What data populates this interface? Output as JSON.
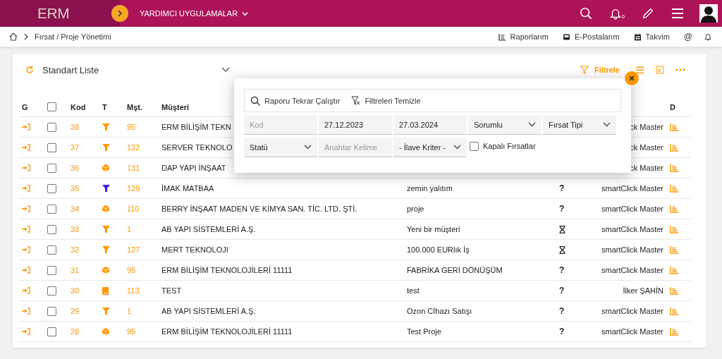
{
  "header": {
    "logo": "ERM",
    "app_menu": "YARDIMCI UYGULAMALAR",
    "notification_count": "0"
  },
  "breadcrumb": {
    "path": "Fırsat / Proje Yönetimi",
    "links": [
      {
        "kind": "reports",
        "label": "Raporlarım"
      },
      {
        "kind": "mail",
        "label": "E-Postalarım"
      },
      {
        "kind": "calendar",
        "label": "Takvim"
      }
    ],
    "at_sign": "@"
  },
  "list": {
    "title": "Standart Liste",
    "filter_label": "Filtrele"
  },
  "table": {
    "header": {
      "g": "G",
      "select_all_checked": false,
      "kod": "Kod",
      "type": "T",
      "mst": "Mşt.",
      "customer": "Müşteri",
      "d": "D"
    },
    "rows": [
      {
        "kod": "38",
        "checked": false,
        "type": {
          "kind": "funnel",
          "color": "#ff9800"
        },
        "mst": "95",
        "customer": "ERM BİLİŞİM TEKN",
        "owner": "ck Master"
      },
      {
        "kod": "37",
        "checked": false,
        "type": {
          "kind": "funnel",
          "color": "#ff9800"
        },
        "mst": "132",
        "customer": "SERVER TEKNOLO",
        "owner": "ck Master"
      },
      {
        "kod": "36",
        "checked": false,
        "type": {
          "kind": "box",
          "color": "#ff9800"
        },
        "mst": "131",
        "customer": "DAP YAPI İNŞAAT",
        "owner": "ck Master"
      },
      {
        "kod": "35",
        "checked": false,
        "type": {
          "kind": "funnel",
          "color": "#3a1ef0"
        },
        "mst": "129",
        "customer": "İMAK MATBAA",
        "subject": "zemin yalıtım",
        "status": {
          "kind": "question",
          "text": "?"
        },
        "owner": "smartClick Master"
      },
      {
        "kod": "34",
        "checked": false,
        "type": {
          "kind": "box",
          "color": "#ff9800"
        },
        "mst": "110",
        "customer": "BERRY İNŞAAT MADEN VE KİMYA SAN. TİC. LTD. ŞTİ.",
        "subject": "proje",
        "status": {
          "kind": "question",
          "text": "?"
        },
        "owner": "smartClick Master"
      },
      {
        "kod": "33",
        "checked": false,
        "type": {
          "kind": "funnel",
          "color": "#ff9800"
        },
        "mst": "1",
        "customer": "AB YAPI SİSTEMLERİ A.Ş.",
        "subject": "Yeni bir müşteri",
        "status": {
          "kind": "hourglass"
        },
        "owner": "smartClick Master"
      },
      {
        "kod": "32",
        "checked": false,
        "type": {
          "kind": "funnel",
          "color": "#ff9800"
        },
        "mst": "127",
        "customer": "MERT TEKNOLOJI",
        "subject": "100.000 EURlık İş",
        "status": {
          "kind": "hourglass"
        },
        "owner": "smartClick Master"
      },
      {
        "kod": "31",
        "checked": false,
        "type": {
          "kind": "box",
          "color": "#ff9800"
        },
        "mst": "95",
        "customer": "ERM BİLİŞİM TEKNOLOJİLERİ 11111",
        "subject": "FABRİKA GERİ DÖNÜŞÜM",
        "status": {
          "kind": "question",
          "text": "?"
        },
        "owner": "smartClick Master"
      },
      {
        "kod": "30",
        "checked": false,
        "type": {
          "kind": "book",
          "color": "#ff9800"
        },
        "mst": "113",
        "customer": "TEST",
        "subject": "test",
        "status": {
          "kind": "question",
          "text": "?"
        },
        "owner": "İlker ŞAHİN"
      },
      {
        "kod": "29",
        "checked": false,
        "type": {
          "kind": "funnel",
          "color": "#ff9800"
        },
        "mst": "1",
        "customer": "AB YAPI SİSTEMLERİ A.Ş.",
        "subject": "Ozon Cİhazı Satışı",
        "status": {
          "kind": "question",
          "text": "?"
        },
        "owner": "smartClick Master"
      },
      {
        "kod": "28",
        "checked": false,
        "type": {
          "kind": "box",
          "color": "#ff9800"
        },
        "mst": "95",
        "customer": "ERM BİLİŞİM TEKNOLOJİLERİ 11111",
        "subject": "Test Proje",
        "status": {
          "kind": "question",
          "text": "?"
        },
        "owner": "smartClick Master"
      }
    ]
  },
  "filter_popup": {
    "toolbar": [
      {
        "kind": "search",
        "label": "Raporu Tekrar Çalıştır"
      },
      {
        "kind": "clear_filter",
        "label": "Filtreleri Temizle"
      }
    ],
    "fields": [
      {
        "kind": "input",
        "placeholder": "Kod"
      },
      {
        "kind": "input",
        "value": "27.12.2023"
      },
      {
        "kind": "input",
        "value": "27.03.2024"
      },
      {
        "kind": "select",
        "value": "Sorumlu"
      },
      {
        "kind": "select",
        "value": "Fırsat Tipi"
      },
      {
        "kind": "select",
        "value": "Statü"
      },
      {
        "kind": "input",
        "placeholder": "Anahtar Kelime"
      },
      {
        "kind": "select",
        "value": "- İlave Kriter -"
      },
      {
        "kind": "checkbox",
        "label": "Kapalı Fırsatlar",
        "checked": false
      }
    ]
  }
}
